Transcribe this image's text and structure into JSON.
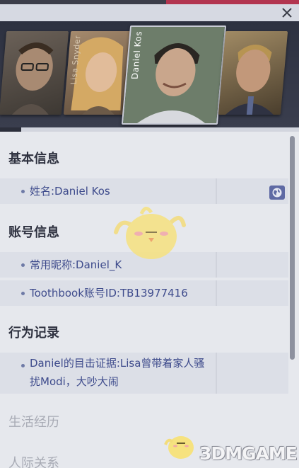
{
  "header": {
    "close_label": "✕"
  },
  "portraits": [
    {
      "name": ""
    },
    {
      "name": "Lisa Snyder"
    },
    {
      "name": "Daniel Kos"
    },
    {
      "name": ""
    }
  ],
  "sections": {
    "basic": {
      "title": "基本信息",
      "items": [
        "姓名:Daniel Kos"
      ]
    },
    "account": {
      "title": "账号信息",
      "items": [
        "常用昵称:Daniel_K",
        "Toothbook账号ID:TB13977416"
      ]
    },
    "behavior": {
      "title": "行为记录",
      "items": [
        "Daniel的目击证据:Lisa曾带着家人骚扰Modi，大吵大闹"
      ]
    },
    "life": {
      "title": "生活经历"
    },
    "relations": {
      "title": "人际关系"
    }
  },
  "watermark": {
    "text": "3DMGAME"
  },
  "colors": {
    "accent_red": "#b2354f",
    "link_text": "#3e4b8c",
    "section_title": "#2f3240"
  }
}
